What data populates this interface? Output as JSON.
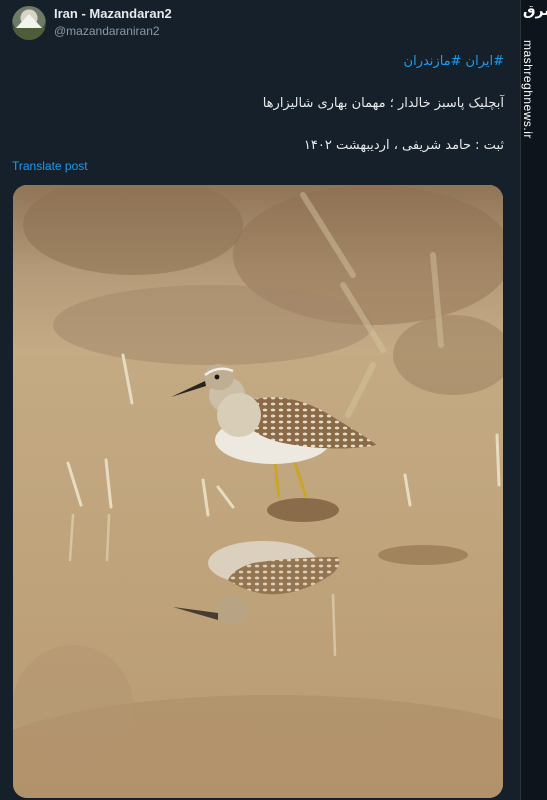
{
  "post": {
    "author": {
      "display_name": "Iran - Mazandaran2",
      "handle": "@mazandaraniran2",
      "avatar_icon": "mountain-avatar-icon"
    },
    "hashtags": [
      "#ایران",
      "#مازندران"
    ],
    "text_line1": "آبچلیک پاسبز خالدار ؛ مهمان بهاری شالیزارها",
    "text_line2": "ثبت : حامد شریفی ، اردیبهشت ۱۴۰۲",
    "translate_label": "Translate post",
    "media_icon": "wood-sandpiper-photo"
  },
  "watermark": {
    "logo_text": "مشرق",
    "site": "mashreghnews.ir"
  },
  "colors": {
    "background": "#15202b",
    "link": "#1d9bf0",
    "text": "#e7e9ea",
    "muted": "#8b98a5"
  }
}
